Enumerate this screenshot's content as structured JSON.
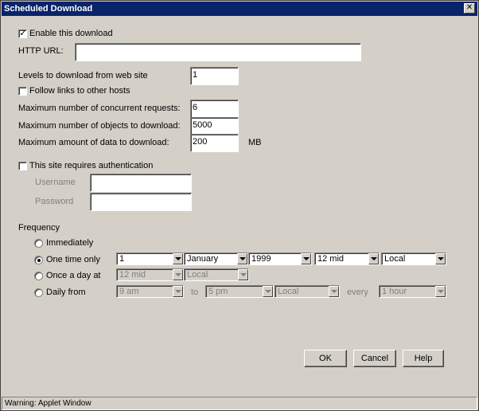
{
  "window": {
    "title": "Scheduled Download",
    "close_glyph": "✕"
  },
  "enable": {
    "label": "Enable this download",
    "checked": true
  },
  "http_url": {
    "label": "HTTP URL:",
    "value": ""
  },
  "levels": {
    "label": "Levels to download from web site",
    "value": "1"
  },
  "follow_links": {
    "label": "Follow links to other hosts",
    "checked": false
  },
  "concurrent": {
    "label": "Maximum number of concurrent requests:",
    "value": "6"
  },
  "objects": {
    "label": "Maximum number of objects to download:",
    "value": "5000"
  },
  "data_amount": {
    "label": "Maximum amount of data to download:",
    "value": "200",
    "unit": "MB"
  },
  "auth": {
    "label": "This site requires authentication",
    "checked": false,
    "username_label": "Username",
    "username_value": "",
    "password_label": "Password",
    "password_value": ""
  },
  "frequency": {
    "label": "Frequency",
    "immediately": {
      "label": "Immediately",
      "selected": false
    },
    "one_time": {
      "label": "One time only",
      "selected": true,
      "day": "1",
      "month": "January",
      "year": "1999",
      "time": "12 mid",
      "zone": "Local"
    },
    "once_a_day": {
      "label": "Once a day at",
      "selected": false,
      "time": "12 mid",
      "zone": "Local"
    },
    "daily_from": {
      "label": "Daily from",
      "selected": false,
      "from": "9 am",
      "to_label": "to",
      "to": "5 pm",
      "zone": "Local",
      "every_label": "every",
      "every": "1 hour"
    }
  },
  "buttons": {
    "ok": "OK",
    "cancel": "Cancel",
    "help": "Help"
  },
  "status": {
    "text": "Warning: Applet Window"
  },
  "icons": {
    "check": "check-icon",
    "radio": "radio-dot-icon",
    "dropdown": "dropdown-arrow-icon"
  },
  "colors": {
    "titlebar": "#0a246a",
    "face": "#d4d0c8"
  }
}
